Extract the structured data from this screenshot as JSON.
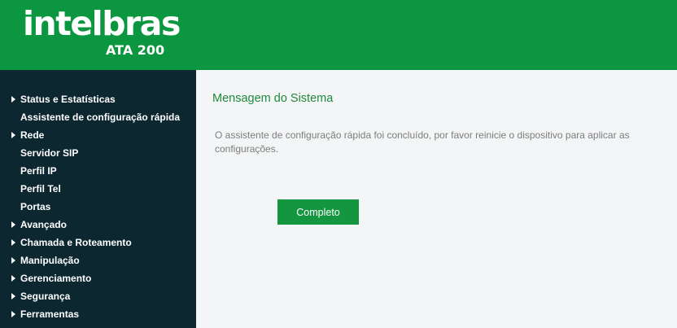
{
  "header": {
    "brand": "intelbras",
    "model": "ATA 200"
  },
  "sidebar": {
    "items": [
      {
        "label": "Status e Estatísticas",
        "arrow": true
      },
      {
        "label": "Assistente de configuração rápida",
        "arrow": false
      },
      {
        "label": "Rede",
        "arrow": true
      },
      {
        "label": "Servidor SIP",
        "arrow": false
      },
      {
        "label": "Perfil IP",
        "arrow": false
      },
      {
        "label": "Perfil Tel",
        "arrow": false
      },
      {
        "label": "Portas",
        "arrow": false
      },
      {
        "label": "Avançado",
        "arrow": true
      },
      {
        "label": "Chamada e Roteamento",
        "arrow": true
      },
      {
        "label": "Manipulação",
        "arrow": true
      },
      {
        "label": "Gerenciamento",
        "arrow": true
      },
      {
        "label": "Segurança",
        "arrow": true
      },
      {
        "label": "Ferramentas",
        "arrow": true
      }
    ]
  },
  "main": {
    "title": "Mensagem do Sistema",
    "message": "O assistente de configuração rápida foi concluído, por favor reinicie o dispositivo para aplicar as configurações.",
    "button_label": "Completo"
  },
  "colors": {
    "header_bg": "#0d9640",
    "sidebar_bg": "#0c2730",
    "title_color": "#1f8a3e",
    "button_bg": "#13963f"
  }
}
